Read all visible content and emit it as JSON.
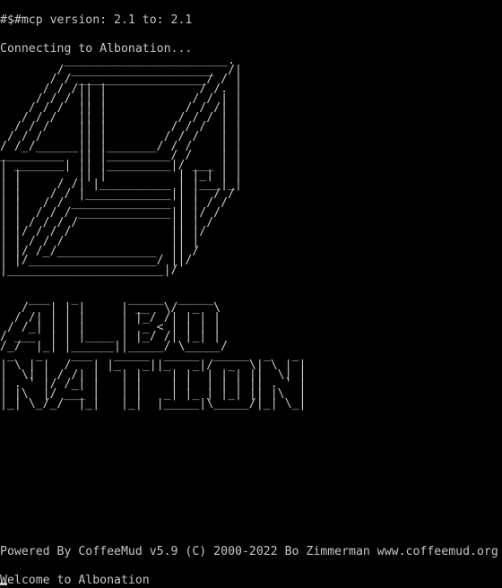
{
  "terminal": {
    "mcp_line": "#$#mcp version: 2.1 to: 2.1",
    "connect_line": "Connecting to Albonation...",
    "banner_art": "         _______________________.\n        / ____________________  /|\n       / / __________________/ / |\n      / / /|| |             / /. |\n     / / / || |            / / | |\n    / / /  || |           / / /| |\n   / / /   || |          / / / | |\n  / / /    || |         / / /  | |\n / / /     || |        / / /   | |\n/ /_/______|| |_______/ / /    | |\n_________  || |_________/ /    | |\n| _______| || |_________|/ ___ | |\n| |        || |          | |_| | |\n| |     / /| |__________ | |___|_|\n| |    / / |____________|| |  / /\n| |   / / ______________ | | / /\n| |  / / / _____________|| |/ /\n| | / / / /             || | /\n| |/ / / /              || |/\n| | / / /               || |\n| |/ /_/______________  || /\n| |/__________________/ ||/\n|______________________|/",
    "title_art_1": "    ___   _       _____  _____\n   /   | | |     | __  \\/  _  \\\n  / /| | | |     | |_/ /| | | |\n / /_| | | |     |  _ < | | | |\n/ ___  | | |____ | |_/ /| |_| |\n/_/  |_| |______||_____/ \\_____/",
    "title_art_2": " _   _    ___   _____  _____  _____  _   _\n| \\ | |  /   | |_   _||_   _|/  _  \\| \\ | |\n|  \\| | / /| |   | |    | |  | | | ||  \\| |\n| . ` |/ /_| |   | |    | |  | | | || . ` |\n| |\\  |/ ___ |   | |   _| |_ | |_| || |\\  |\n|_| \\_/_/  |_|   |_|  |_____|\\_____/|_| \\_|",
    "powered_line": "Powered By CoffeeMud v5.9 (C) 2000-2022 Bo Zimmerman www.coffeemud.org",
    "welcome_line": "Welcome to Albonation"
  }
}
